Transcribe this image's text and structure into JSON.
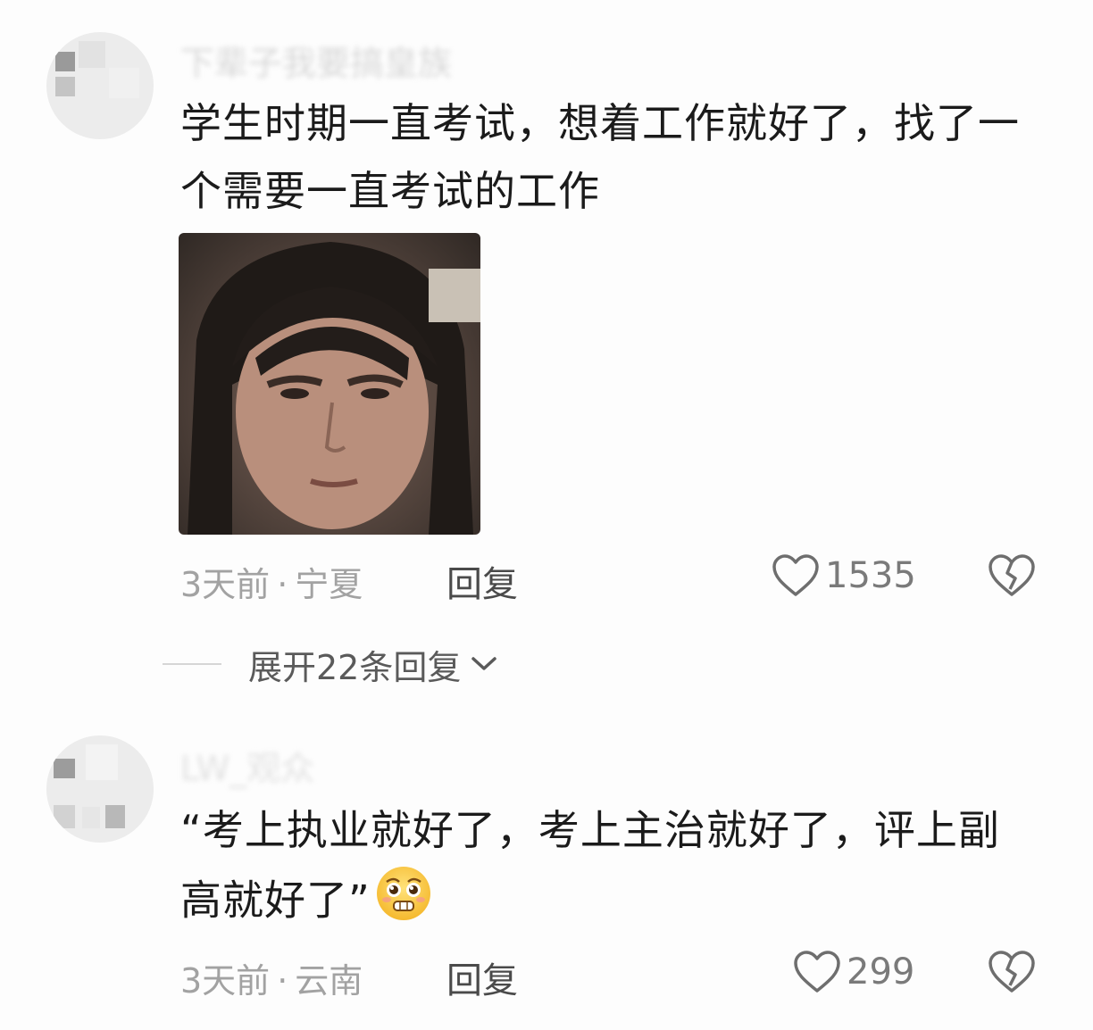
{
  "comments": [
    {
      "username": "下辈子我要搞皇族",
      "text": "学生时期一直考试，想着工作就好了，找了一个需要一直考试的工作",
      "time": "3天前",
      "separator": "·",
      "location": "宁夏",
      "reply_label": "回复",
      "likes": "1535",
      "expand_replies_label": "展开22条回复"
    },
    {
      "username": "LW_观众",
      "text": "“考上执业就好了，考上主治就好了，评上副高就好了”",
      "time": "3天前",
      "separator": "·",
      "location": "云南",
      "reply_label": "回复",
      "likes": "299"
    }
  ],
  "icons": {
    "like": "heart-outline-icon",
    "dislike": "broken-heart-icon",
    "expand": "chevron-down-icon",
    "emoji": "pleading-face-emoji"
  },
  "colors": {
    "text_primary": "#1b1b1b",
    "text_secondary": "#a2a2a2",
    "reply": "#4a4a4a",
    "background": "#fdfdfd"
  }
}
